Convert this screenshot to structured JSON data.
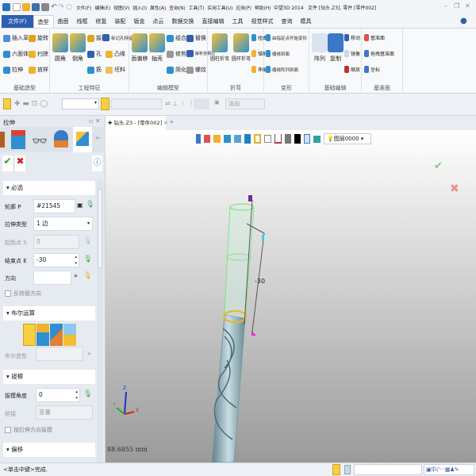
{
  "title_bar": {
    "menus": [
      "文件(F)",
      "编辑(E)",
      "视图(V)",
      "插入(I)",
      "属性(A)",
      "查询(N)",
      "工具(T)",
      "实用工具(U)",
      "应用(P)",
      "帮助(H)"
    ],
    "app_title": "中望3D 2014",
    "doc_title": "文件 [钻头.Z3], 零件 [零件002]"
  },
  "ribbon_tabs": [
    "文件(F)",
    "造型",
    "曲面",
    "线框",
    "修复",
    "装配",
    "钣金",
    "点云",
    "数据交换",
    "直接编辑",
    "工具",
    "视觉样式",
    "查询",
    "模具"
  ],
  "ribbon": {
    "basic_shape": {
      "label": "基础造型",
      "items": [
        "插入草图",
        "旋转",
        "六面体",
        "扫掠",
        "拉伸",
        "放样"
      ]
    },
    "eng_feature": {
      "label": "工程特征",
      "big": [
        "圆角",
        "倒角"
      ],
      "items": [
        "拔模",
        "标记孔特征",
        "孔",
        "凸缘",
        "筋",
        "坯料"
      ]
    },
    "edit_model": {
      "label": "编辑模型",
      "big": [
        "面偏移",
        "抽壳"
      ],
      "items": [
        "组合",
        "替换",
        "修剪",
        "解析自相交",
        "简化",
        "螺纹"
      ]
    },
    "bend": {
      "label": "折弯",
      "big": [
        "圆柱折弯",
        "圆环折弯"
      ],
      "items": [
        "扭曲",
        "锥削",
        "伸展"
      ]
    },
    "deform": {
      "label": "变形",
      "items": [
        "由指定点开始变形",
        "缠绕到面",
        "缠绕阵列到面"
      ]
    },
    "basic_edit": {
      "label": "基础编辑",
      "big": [
        "阵列",
        "复制"
      ],
      "items": [
        "移动",
        "镜像",
        "缩放"
      ]
    },
    "datum": {
      "label": "基准面",
      "items": [
        "基准面",
        "拖拽基准面",
        "坐标"
      ]
    }
  },
  "toolbar": {
    "filter_placeholder": "",
    "rule_label": "法向"
  },
  "panel": {
    "title": "拉伸",
    "required": {
      "header": "必选",
      "profile_label": "轮廓 P",
      "profile_value": "#21545",
      "type_label": "拉伸类型",
      "type_value": "1 边",
      "start_label": "起始点 S",
      "start_value": "0",
      "end_label": "结束点 E",
      "end_value": "-30",
      "dir_label": "方向",
      "dir_value": "",
      "flip_label": "反转面方向"
    },
    "boolean": {
      "header": "布尔运算",
      "body_label": "布尔造型"
    },
    "draft": {
      "header": "拔模",
      "angle_label": "拔模角度",
      "angle_value": "0",
      "bevel_label": "桥接",
      "bevel_value": "变量",
      "option_label": "按拉伸方向拔模"
    },
    "offset": {
      "header": "偏移"
    }
  },
  "document_tab": "钻头.Z3 - [零件002]",
  "view_toolbar": {
    "layer": "图层0000"
  },
  "viewport": {
    "dimension": "-30",
    "scale_readout": "88.6855 mm",
    "axes": [
      "X",
      "Y",
      "Z"
    ]
  },
  "status": {
    "prompt": "<单击中键>完成."
  }
}
